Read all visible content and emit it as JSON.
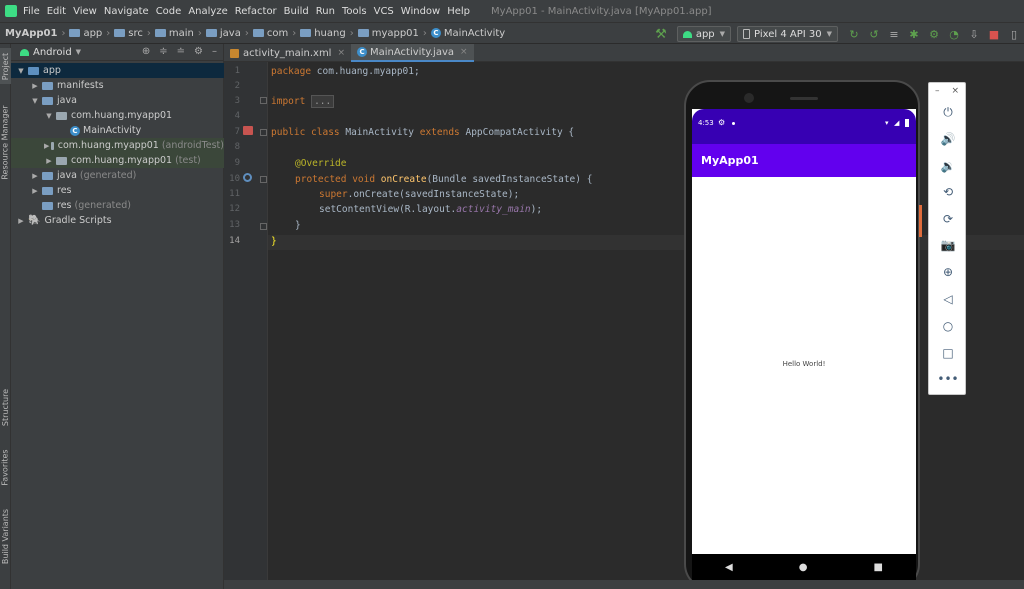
{
  "menu": [
    "File",
    "Edit",
    "View",
    "Navigate",
    "Code",
    "Analyze",
    "Refactor",
    "Build",
    "Run",
    "Tools",
    "VCS",
    "Window",
    "Help"
  ],
  "window_title": "MyApp01 - MainActivity.java [MyApp01.app]",
  "breadcrumbs": [
    "MyApp01",
    "app",
    "src",
    "main",
    "java",
    "com",
    "huang",
    "myapp01",
    "MainActivity"
  ],
  "toolbar": {
    "run_config": "app",
    "device": "Pixel 4 API 30"
  },
  "left_strip": [
    "Project",
    "Resource Manager",
    "Structure",
    "Favorites",
    "Build Variants"
  ],
  "project_panel": {
    "view_mode": "Android",
    "tree": [
      {
        "label": "app",
        "suffix": ""
      },
      {
        "label": "manifests",
        "suffix": ""
      },
      {
        "label": "java",
        "suffix": ""
      },
      {
        "label": "com.huang.myapp01",
        "suffix": ""
      },
      {
        "label": "MainActivity",
        "suffix": ""
      },
      {
        "label": "com.huang.myapp01",
        "suffix": "(androidTest)"
      },
      {
        "label": "com.huang.myapp01",
        "suffix": "(test)"
      },
      {
        "label": "java",
        "suffix": "(generated)"
      },
      {
        "label": "res",
        "suffix": ""
      },
      {
        "label": "res",
        "suffix": "(generated)"
      },
      {
        "label": "Gradle Scripts",
        "suffix": ""
      }
    ]
  },
  "editor_tabs": [
    {
      "label": "activity_main.xml"
    },
    {
      "label": "MainActivity.java"
    }
  ],
  "code": {
    "line_numbers": [
      "1",
      "2",
      "3",
      "4",
      "7",
      "8",
      "9",
      "10",
      "11",
      "12",
      "13",
      "14"
    ],
    "l1_kw": "package",
    "l1_rest": " com.huang.myapp01;",
    "l3_kw": "import",
    "l3_fold": "...",
    "l7_kw1": "public class",
    "l7_name": " MainActivity ",
    "l7_kw2": "extends",
    "l7_rest": " AppCompatActivity {",
    "l9_ann": "@Override",
    "l10_kw": "protected void",
    "l10_fn": " onCreate",
    "l10_rest": "(Bundle savedInstanceState) {",
    "l11_kw": "super",
    "l11_rest": ".onCreate(savedInstanceState);",
    "l12_a": "setContentView(R.layout.",
    "l12_it": "activity_main",
    "l12_b": ");",
    "l13": "}",
    "l14": "}"
  },
  "phone": {
    "time": "4:53",
    "app_title": "MyApp01",
    "hello": "Hello World!"
  },
  "emulator_panel": {
    "minimize": "–",
    "close": "×"
  }
}
